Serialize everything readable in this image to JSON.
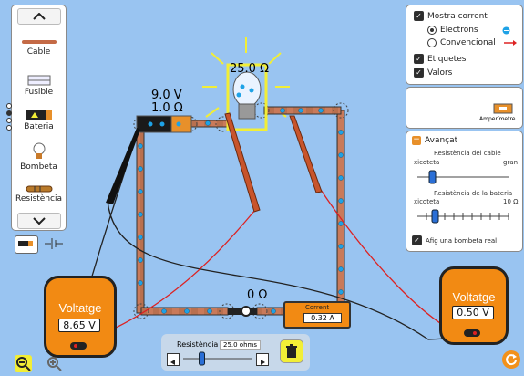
{
  "toolbox": {
    "items": [
      {
        "label": "Cable"
      },
      {
        "label": "Fusible"
      },
      {
        "label": "Bateria"
      },
      {
        "label": "Bombeta"
      },
      {
        "label": "Resistència"
      }
    ]
  },
  "tools": {
    "wire_icon": "wire-toggle-icon",
    "schematic_icon": "schematic-toggle-icon"
  },
  "view_panel": {
    "show_current": "Mostra corrent",
    "electrons": "Electrons",
    "conventional": "Convencional",
    "labels": "Etiquetes",
    "values": "Valors",
    "electrons_selected": true,
    "labels_checked": true,
    "values_checked": true,
    "show_current_checked": true
  },
  "ammeter_panel": {
    "label": "Amperímetre"
  },
  "advanced": {
    "title": "Avançat",
    "wire_resistance_label": "Resistència del cable",
    "wire_min": "xicoteta",
    "wire_max": "gran",
    "battery_resistance_label": "Resistència de la bateria",
    "battery_min": "xicoteta",
    "battery_max": "10 Ω",
    "real_bulb": "Afig una bombeta real",
    "real_bulb_checked": true,
    "wire_resistance_value": 0.05,
    "battery_resistance_value": 0.1
  },
  "circuit": {
    "battery_voltage": "9.0 V",
    "battery_resistance": "1.0 Ω",
    "bulb_resistance": "25.0 Ω",
    "switch_resistance": "0 Ω",
    "ammeter_label": "Corrent",
    "ammeter_value": "0.32 A"
  },
  "voltmeter_left": {
    "title": "Voltatge",
    "reading": "8.65 V"
  },
  "voltmeter_right": {
    "title": "Voltatge",
    "reading": "0.50 V"
  },
  "resistance_slider": {
    "label": "Resistència",
    "value": "25.0 ohms",
    "level": 0.25
  },
  "zoom": {
    "out": "zoom-out-icon",
    "in": "zoom-in-icon"
  },
  "colors": {
    "background": "#99c4f1",
    "meter": "#f28a13",
    "bulb_highlight": "#f2ee36"
  }
}
